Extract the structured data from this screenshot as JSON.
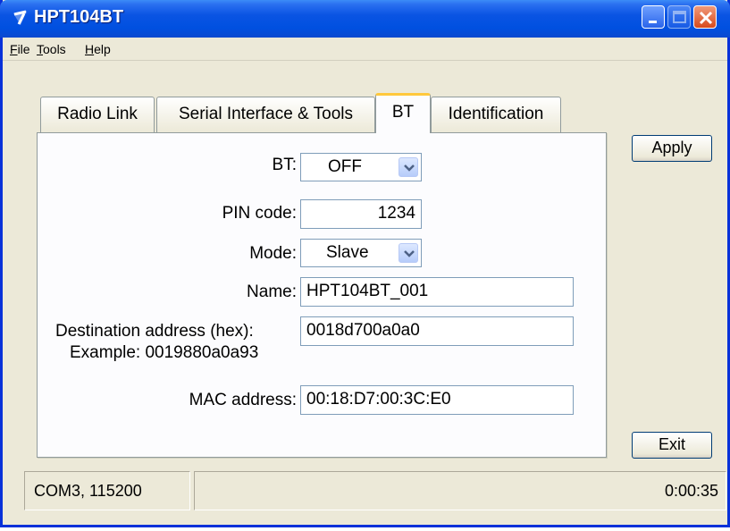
{
  "window": {
    "title": "HPT104BT"
  },
  "menu": {
    "file_u": "F",
    "file_rest": "ile",
    "tools_u": "T",
    "tools_rest": "ools",
    "help_u": "H",
    "help_rest": "elp"
  },
  "tabs": [
    {
      "label": "Radio Link"
    },
    {
      "label": "Serial Interface & Tools"
    },
    {
      "label": "BT"
    },
    {
      "label": "Identification"
    }
  ],
  "form": {
    "bt_label": "BT:",
    "bt_value": "OFF",
    "pin_label": "PIN code:",
    "pin_value": "1234",
    "mode_label": "Mode:",
    "mode_value": "Slave",
    "name_label": "Name:",
    "name_value": "HPT104BT_001",
    "dest_label": "Destination address (hex):",
    "dest_example": "Example: 0019880a0a93",
    "dest_value": "0018d700a0a0",
    "mac_label": "MAC address:",
    "mac_value": "00:18:D7:00:3C:E0"
  },
  "buttons": {
    "apply": "Apply",
    "exit": "Exit"
  },
  "status": {
    "port": "COM3, 115200",
    "elapsed": "0:00:35"
  },
  "icons": {
    "app": "antenna-icon",
    "combo_arrow": "chevron-down-icon"
  },
  "colors": {
    "titlebar": "#0a54e3",
    "window_bg": "#ece9d8",
    "active_tab_accent": "#ffc83c",
    "close_button": "#d84a1c"
  }
}
